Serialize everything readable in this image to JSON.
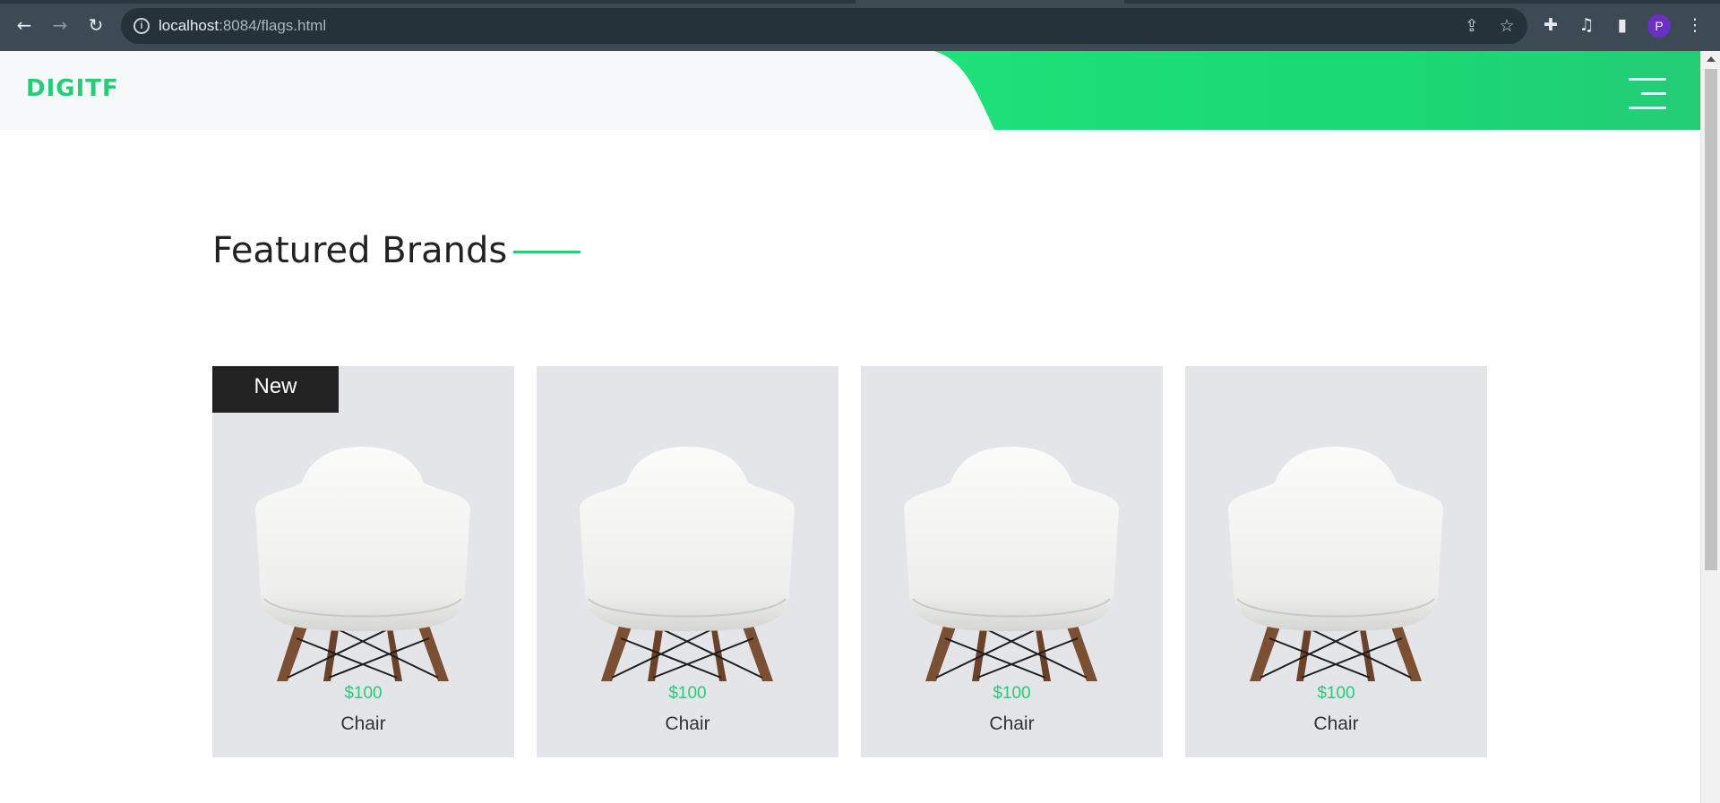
{
  "browser": {
    "url_host": "localhost",
    "url_path": ":8084/flags.html",
    "profile_initial": "P",
    "icons": [
      "back-arrow-icon",
      "forward-arrow-icon",
      "reload-icon",
      "info-icon",
      "share-icon",
      "star-icon",
      "extensions-icon",
      "media-icon",
      "sidepanel-icon",
      "more-vert-icon"
    ]
  },
  "header": {
    "logo": "DIGITF",
    "accent_color": "#26cc76"
  },
  "section": {
    "title": "Featured Brands"
  },
  "products": [
    {
      "badge": "New",
      "price": "$100",
      "name": "Chair"
    },
    {
      "badge": "",
      "price": "$100",
      "name": "Chair"
    },
    {
      "badge": "",
      "price": "$100",
      "name": "Chair"
    },
    {
      "badge": "",
      "price": "$100",
      "name": "Chair"
    }
  ]
}
